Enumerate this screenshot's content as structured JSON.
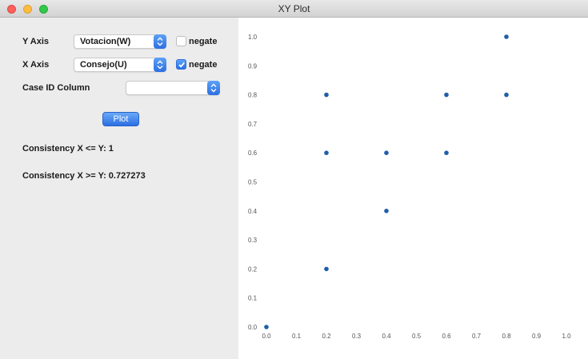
{
  "window": {
    "title": "XY Plot"
  },
  "controls": {
    "y_axis": {
      "label": "Y Axis",
      "selected": "Votacion(W)",
      "negate_label": "negate",
      "negate_checked": false
    },
    "x_axis": {
      "label": "X Axis",
      "selected": "Consejo(U)",
      "negate_label": "negate",
      "negate_checked": true
    },
    "case_id": {
      "label": "Case ID Column",
      "selected": ""
    },
    "plot_button": "Plot"
  },
  "results": {
    "consistency_le": "Consistency X <= Y: 1",
    "consistency_ge": "Consistency X >= Y: 0.727273"
  },
  "chart_data": {
    "type": "scatter",
    "title": "",
    "xlabel": "",
    "ylabel": "",
    "xlim": [
      0,
      1
    ],
    "ylim": [
      0,
      1
    ],
    "x_ticks": [
      "0.0",
      "0.1",
      "0.2",
      "0.3",
      "0.4",
      "0.5",
      "0.6",
      "0.7",
      "0.8",
      "0.9",
      "1.0"
    ],
    "y_ticks": [
      "0.0",
      "0.1",
      "0.2",
      "0.3",
      "0.4",
      "0.5",
      "0.6",
      "0.7",
      "0.8",
      "0.9",
      "1.0"
    ],
    "grid": false,
    "point_color": "#1f5fa8",
    "points": [
      {
        "x": 0.0,
        "y": 0.0
      },
      {
        "x": 0.2,
        "y": 0.2
      },
      {
        "x": 0.4,
        "y": 0.4
      },
      {
        "x": 0.2,
        "y": 0.6
      },
      {
        "x": 0.4,
        "y": 0.6
      },
      {
        "x": 0.6,
        "y": 0.6
      },
      {
        "x": 0.2,
        "y": 0.8
      },
      {
        "x": 0.6,
        "y": 0.8
      },
      {
        "x": 0.8,
        "y": 0.8
      },
      {
        "x": 0.8,
        "y": 1.0
      }
    ]
  }
}
